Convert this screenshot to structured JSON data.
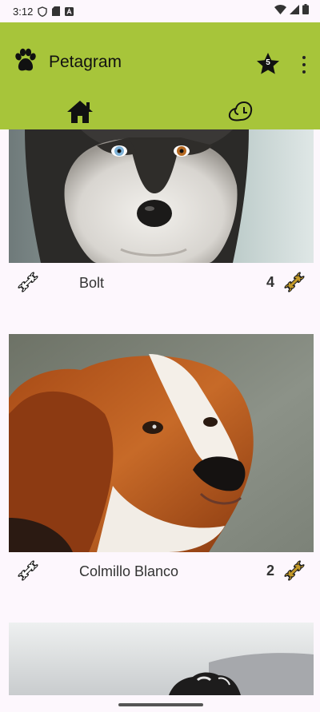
{
  "status_bar": {
    "time": "3:12",
    "icons": [
      "shield-icon",
      "sd-card-icon",
      "keyboard-icon",
      "wifi-icon",
      "signal-icon",
      "battery-icon"
    ]
  },
  "toolbar": {
    "app_icon": "paw-icon",
    "title": "Petagram",
    "favorites_icon": "star-icon",
    "favorites_count": "5",
    "menu_icon": "overflow-menu-icon"
  },
  "tabs": [
    {
      "icon": "home-icon",
      "selected": true
    },
    {
      "icon": "dog-profile-icon",
      "selected": false
    }
  ],
  "pets": [
    {
      "name": "Bolt",
      "likes": "4",
      "photo": "husky"
    },
    {
      "name": "Colmillo Blanco",
      "likes": "2",
      "photo": "red-dog"
    },
    {
      "name": "",
      "likes": "",
      "photo": "border-collie"
    }
  ],
  "colors": {
    "appbar": "#a7c53a",
    "background": "#fdf7fd",
    "bone_filled": "#c49a28"
  }
}
